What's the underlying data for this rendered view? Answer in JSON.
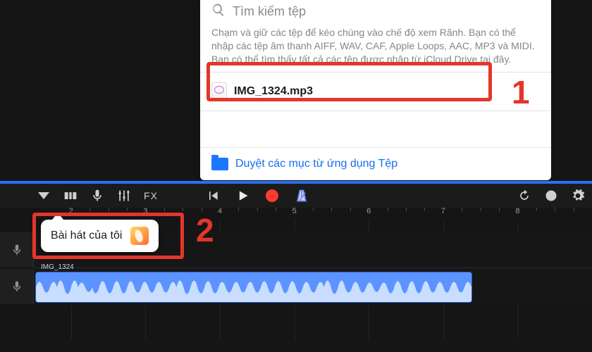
{
  "search": {
    "placeholder": "Tìm kiếm tệp"
  },
  "hint": "Chạm và giữ các tệp để kéo chúng vào chế độ xem Rãnh. Bạn có thể nhập các tệp âm thanh AIFF, WAV, CAF, Apple Loops, AAC, MP3 và MIDI. Bạn có thể tìm thấy tất cả các tệp được nhập từ iCloud Drive tại đây.",
  "file": {
    "name": "IMG_1324.mp3"
  },
  "browse": {
    "label": "Duyệt các mục từ ứng dụng Tệp"
  },
  "popover": {
    "title": "Bài hát của tôi"
  },
  "clip": {
    "label": "IMG_1324"
  },
  "annotations": {
    "n1": "1",
    "n2": "2"
  },
  "toolbar": {
    "fx": "FX"
  },
  "ruler": {
    "marks": [
      "2",
      "3",
      "4",
      "5",
      "6",
      "7",
      "8"
    ]
  }
}
